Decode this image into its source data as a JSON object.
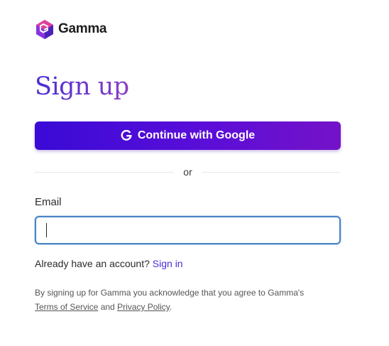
{
  "brand": {
    "name": "Gamma",
    "logo_icon": "gamma-cube-icon",
    "accent": "#4a2cd8"
  },
  "page": {
    "title": "Sign up"
  },
  "google": {
    "label": "Continue with Google",
    "icon": "google-g-icon"
  },
  "divider": {
    "text": "or"
  },
  "email": {
    "label": "Email",
    "value": "",
    "placeholder": ""
  },
  "signin": {
    "prompt": "Already have an account?",
    "link": "Sign in"
  },
  "legal": {
    "text": "By signing up for Gamma you acknowledge that you agree to Gamma's",
    "terms": "Terms of Service",
    "and": "and",
    "privacy": "Privacy Policy",
    "end": "."
  }
}
